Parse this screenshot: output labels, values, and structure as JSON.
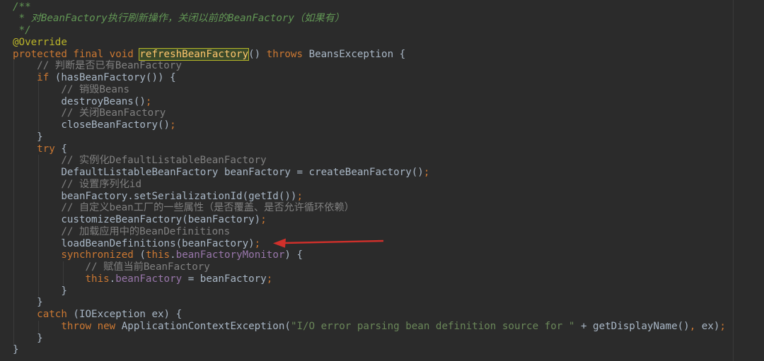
{
  "editor": {
    "lines": [
      [
        {
          "t": "/**",
          "c": "doc"
        }
      ],
      [
        {
          "t": " * 对",
          "c": "doc"
        },
        {
          "t": "BeanFactory",
          "c": "doc-code"
        },
        {
          "t": "执行刷新操作，关闭以前的",
          "c": "doc"
        },
        {
          "t": "BeanFactory",
          "c": "doc-code"
        },
        {
          "t": "（如果有）",
          "c": "doc"
        }
      ],
      [
        {
          "t": " */",
          "c": "doc"
        }
      ],
      [
        {
          "t": "@Override",
          "c": "ann"
        }
      ],
      [
        {
          "t": "protected ",
          "c": "kw"
        },
        {
          "t": "final ",
          "c": "kw"
        },
        {
          "t": "void ",
          "c": "kw"
        },
        {
          "t": "refreshBeanFactory",
          "c": "method-hl"
        },
        {
          "t": "() "
        },
        {
          "t": "throws ",
          "c": "kw"
        },
        {
          "t": "BeansException {"
        }
      ],
      [
        {
          "t": "    "
        },
        {
          "t": "// 判断是否已有BeanFactory",
          "c": "comment"
        }
      ],
      [
        {
          "t": "    "
        },
        {
          "t": "if ",
          "c": "kw"
        },
        {
          "t": "(hasBeanFactory()) {"
        }
      ],
      [
        {
          "t": "        "
        },
        {
          "t": "// 销毁Beans",
          "c": "comment"
        }
      ],
      [
        {
          "t": "        destroyBeans()"
        },
        {
          "t": ";",
          "c": "kw"
        }
      ],
      [
        {
          "t": "        "
        },
        {
          "t": "// 关闭BeanFactory",
          "c": "comment"
        }
      ],
      [
        {
          "t": "        closeBeanFactory()"
        },
        {
          "t": ";",
          "c": "kw"
        }
      ],
      [
        {
          "t": "    }"
        }
      ],
      [
        {
          "t": "    "
        },
        {
          "t": "try ",
          "c": "kw"
        },
        {
          "t": "{"
        }
      ],
      [
        {
          "t": "        "
        },
        {
          "t": "// 实例化DefaultListableBeanFactory",
          "c": "comment"
        }
      ],
      [
        {
          "t": "        DefaultListableBeanFactory beanFactory = createBeanFactory()"
        },
        {
          "t": ";",
          "c": "kw"
        }
      ],
      [
        {
          "t": "        "
        },
        {
          "t": "// 设置序列化id",
          "c": "comment"
        }
      ],
      [
        {
          "t": "        beanFactory.setSerializationId(getId())"
        },
        {
          "t": ";",
          "c": "kw"
        }
      ],
      [
        {
          "t": "        "
        },
        {
          "t": "// 自定义bean工厂的一些属性（是否覆盖、是否允许循环依赖）",
          "c": "comment"
        }
      ],
      [
        {
          "t": "        customizeBeanFactory(beanFactory)"
        },
        {
          "t": ";",
          "c": "kw"
        }
      ],
      [
        {
          "t": "        "
        },
        {
          "t": "// 加载应用中的BeanDefinitions",
          "c": "comment"
        }
      ],
      [
        {
          "t": "        loadBeanDefinitions(beanFactory)"
        },
        {
          "t": ";",
          "c": "kw"
        }
      ],
      [
        {
          "t": "        "
        },
        {
          "t": "synchronized ",
          "c": "kw"
        },
        {
          "t": "("
        },
        {
          "t": "this",
          "c": "kw"
        },
        {
          "t": "."
        },
        {
          "t": "beanFactoryMonitor",
          "c": "field"
        },
        {
          "t": ") {"
        }
      ],
      [
        {
          "t": "            "
        },
        {
          "t": "// 赋值当前BeanFactory",
          "c": "comment"
        }
      ],
      [
        {
          "t": "            "
        },
        {
          "t": "this",
          "c": "kw"
        },
        {
          "t": "."
        },
        {
          "t": "beanFactory ",
          "c": "field"
        },
        {
          "t": "= beanFactory"
        },
        {
          "t": ";",
          "c": "kw"
        }
      ],
      [
        {
          "t": "        }"
        }
      ],
      [
        {
          "t": "    }"
        }
      ],
      [
        {
          "t": "    "
        },
        {
          "t": "catch ",
          "c": "kw"
        },
        {
          "t": "(IOException ex) {"
        }
      ],
      [
        {
          "t": "        "
        },
        {
          "t": "throw ",
          "c": "kw"
        },
        {
          "t": "new ",
          "c": "kw"
        },
        {
          "t": "ApplicationContextException("
        },
        {
          "t": "\"I/O error parsing bean definition source for \"",
          "c": "str"
        },
        {
          "t": " + getDisplayName()"
        },
        {
          "t": ", ",
          "c": "kw"
        },
        {
          "t": "ex)"
        },
        {
          "t": ";",
          "c": "kw"
        }
      ],
      [
        {
          "t": "    }"
        }
      ],
      [
        {
          "t": "}"
        }
      ]
    ]
  },
  "colors": {
    "background": "#2b2b2b",
    "plain": "#a9b7c6",
    "keyword": "#cc7832",
    "comment": "#808080",
    "doc_comment": "#629755",
    "annotation": "#bbb529",
    "field": "#9876aa",
    "string": "#6a8759",
    "method_highlight": "#ffc66d",
    "arrow": "#d0302b"
  }
}
